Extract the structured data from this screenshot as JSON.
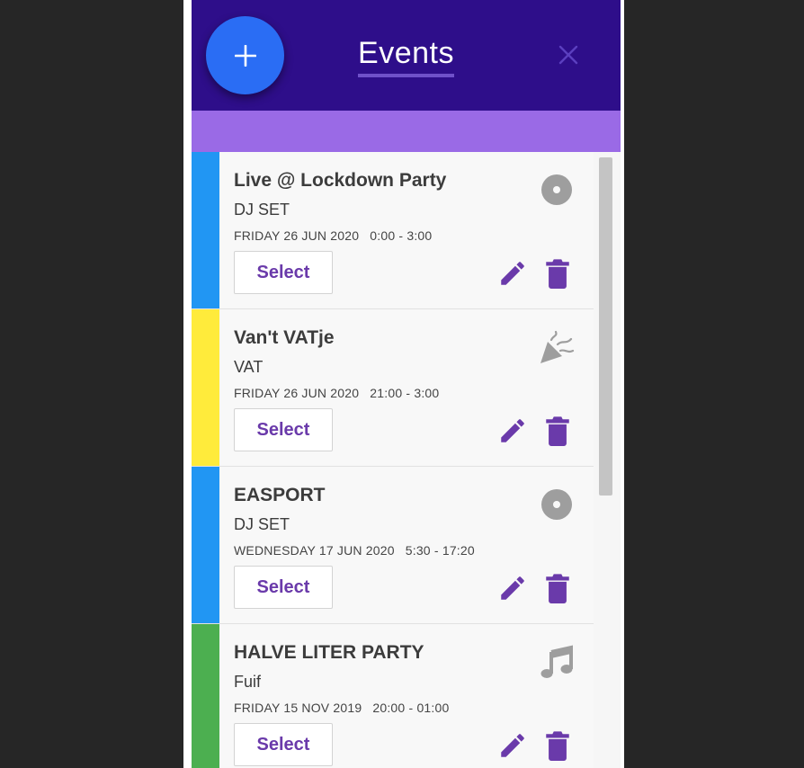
{
  "app": {
    "title": "Events",
    "add_icon": "plus-icon",
    "close_icon": "close-icon"
  },
  "colors": {
    "header": "#2e0e8a",
    "band": "#9a6ae6",
    "fab": "#2a6df4",
    "accent": "#6a3aaa",
    "icon_gray": "#9e9e9e"
  },
  "events": [
    {
      "name": "Live @ Lockdown Party",
      "type": "DJ SET",
      "date": "FRIDAY 26 JUN 2020",
      "time": "0:00 - 3:00",
      "stripe_color": "#2196f3",
      "icon": "disc-icon",
      "select_label": "Select"
    },
    {
      "name": "Van't VATje",
      "type": "VAT",
      "date": "FRIDAY 26 JUN 2020",
      "time": "21:00 - 3:00",
      "stripe_color": "#ffeb3b",
      "icon": "party-popper-icon",
      "select_label": "Select"
    },
    {
      "name": "EASPORT",
      "type": "DJ SET",
      "date": "WEDNESDAY 17 JUN 2020",
      "time": "5:30 - 17:20",
      "stripe_color": "#2196f3",
      "icon": "disc-icon",
      "select_label": "Select"
    },
    {
      "name": "HALVE LITER PARTY",
      "type": "Fuif",
      "date": "FRIDAY 15 NOV 2019",
      "time": "20:00 - 01:00",
      "stripe_color": "#4caf50",
      "icon": "music-note-icon",
      "select_label": "Select"
    }
  ]
}
